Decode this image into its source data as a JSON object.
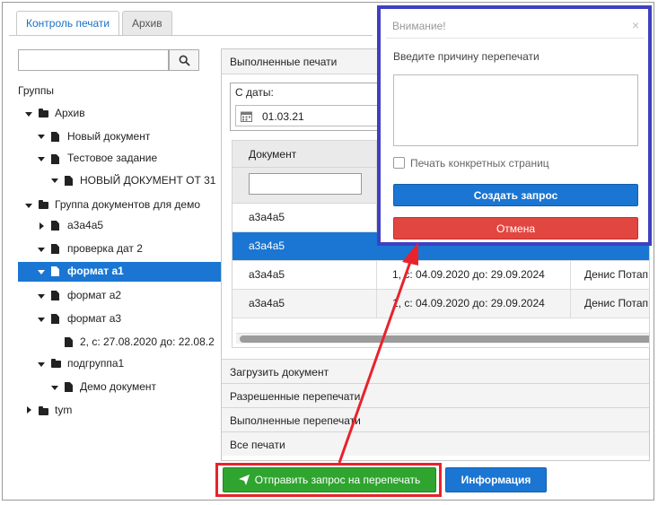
{
  "tabs": [
    {
      "label": "Контроль печати",
      "active": true
    },
    {
      "label": "Архив",
      "active": false
    }
  ],
  "sidebar": {
    "groups_label": "Группы",
    "tree": [
      {
        "label": "Архив"
      },
      {
        "label": "Новый документ"
      },
      {
        "label": "Тестовое задание"
      },
      {
        "label": "НОВЫЙ ДОКУМЕНТ ОТ 31"
      },
      {
        "label": "Группа документов для демо"
      },
      {
        "label": "а3а4а5"
      },
      {
        "label": "проверка дат 2"
      },
      {
        "label": "формат а1"
      },
      {
        "label": "формат а2"
      },
      {
        "label": "формат а3"
      },
      {
        "label": "2, с: 27.08.2020 до: 22.08.2"
      },
      {
        "label": "подгруппа1"
      },
      {
        "label": "Демо документ"
      },
      {
        "label": "tym"
      }
    ]
  },
  "main": {
    "panel_title": "Выполненные печати",
    "date_from_label": "С даты:",
    "date_from_value": "01.03.21",
    "table": {
      "column_document": "Документ",
      "rows": [
        {
          "document": "а3а4а5",
          "period": "",
          "user": ""
        },
        {
          "document": "а3а4а5",
          "period": "",
          "user": ""
        },
        {
          "document": "а3а4а5",
          "period": "1, с: 04.09.2020 до: 29.09.2024",
          "user": "Денис Потап"
        },
        {
          "document": "а3а4а5",
          "period": "1, с: 04.09.2020 до: 29.09.2024",
          "user": "Денис Потап"
        }
      ]
    },
    "accordion": [
      "Загрузить документ",
      "Разрешенные перепечати",
      "Выполненные перепечати",
      "Все печати"
    ]
  },
  "footer": {
    "send_label": "Отправить запрос на перепечать",
    "info_label": "Информация"
  },
  "dialog": {
    "title": "Внимание!",
    "close": "×",
    "prompt": "Введите причину перепечати",
    "checkbox_label": "Печать конкретных страниц",
    "create_label": "Создать запрос",
    "cancel_label": "Отмена"
  },
  "colors": {
    "accent_blue": "#1a76d2",
    "send_green": "#2fa52f",
    "cancel_red": "#e24640",
    "highlight_red": "#e8232b",
    "dialog_border": "#3f3fc2"
  }
}
